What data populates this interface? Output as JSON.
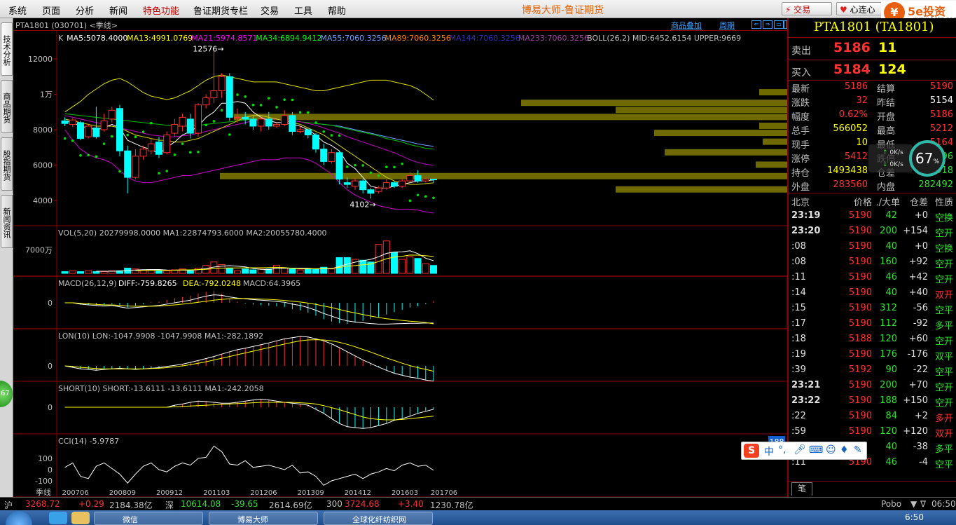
{
  "menubar": {
    "items": [
      "系统",
      "页面",
      "分析",
      "新闻",
      "特色功能",
      "鲁证期货专栏",
      "交易",
      "工具",
      "帮助"
    ],
    "app_title": "博易大师-鲁证期货",
    "trade_button": "交易",
    "xinlian_button": "心连心",
    "logo_brand": "5e投资",
    "logo_url": "www.5etz.com"
  },
  "left_tabs": [
    "技术分析",
    "商品期货",
    "股指期货",
    "新闻资讯"
  ],
  "float_ball": "67",
  "chart": {
    "symbol": "PTA1801 (030701) <季线>",
    "links": [
      "商品叠加",
      "周期"
    ],
    "nav_icons": [
      "prev-icon",
      "next-icon",
      "zoom-in-icon",
      "zoom-out-icon"
    ],
    "ma_line": [
      {
        "text": "K",
        "color": "#c0c0c0"
      },
      {
        "text": "MA5:5078.4000",
        "color": "#ffffff"
      },
      {
        "text": "MA13:4991.0769",
        "color": "#ffff00"
      },
      {
        "text": "MA21:5974.8571",
        "color": "#ff00ff"
      },
      {
        "text": "MA34:6894.9412",
        "color": "#00ff00"
      },
      {
        "text": "MA55:7060.3256",
        "color": "#6ea0ff"
      },
      {
        "text": "MA89:7060.3256",
        "color": "#ff8000"
      },
      {
        "text": "MA144:7060.3256",
        "color": "#3030c0"
      },
      {
        "text": "MA233:7060.3256",
        "color": "#a040a0"
      },
      {
        "text": "BOLL(26,2) MID:6452.6154 UPPER:9669",
        "color": "#c0c0c0"
      }
    ],
    "price_ylabels": [
      "12000",
      "1万",
      "8000",
      "6000",
      "4000"
    ],
    "annotations": {
      "high": "12576→",
      "low": "4102→"
    },
    "vol_label": "VOL(5,20) 20279998.0000 MA1:22874793.6000 MA2:20055780.4000",
    "vol_ylabel": "7000万",
    "macd_label_parts": [
      {
        "text": "MACD(26,12,9)",
        "color": "#c0c0c0"
      },
      {
        "text": "DIFF:-759.8265",
        "color": "#ffffff"
      },
      {
        "text": "DEA:-792.0248",
        "color": "#ffff00"
      },
      {
        "text": "MACD:64.3965",
        "color": "#c0c0c0"
      }
    ],
    "lon_label": "LON(10) LON:-1047.9908 -1047.9908 MA1:-282.1892",
    "short_label": "SHORT(10) SHORT:-13.6111 -13.6111 MA1:-242.2058",
    "cci_label": "CCI(14) -5.9787",
    "zero_label": "0",
    "cci_ylabels": [
      "100",
      "0",
      "-100"
    ],
    "x_axis": {
      "period": "季线",
      "labels": [
        "200706",
        "200809",
        "200912",
        "201103",
        "201206",
        "201309",
        "201412",
        "201603",
        "201706"
      ]
    },
    "badge_188": "188"
  },
  "quote": {
    "title": "PTA1801 (TA1801)",
    "sell": {
      "label": "卖出",
      "price": "5186",
      "vol": "11"
    },
    "buy": {
      "label": "买入",
      "price": "5184",
      "vol": "124"
    },
    "rows": [
      {
        "k1": "最新",
        "v1": "5186",
        "c1": "#ff3030",
        "k2": "结算",
        "v2": "5190",
        "c2": "#ff3030"
      },
      {
        "k1": "涨跌",
        "v1": "32",
        "c1": "#ff3030",
        "k2": "昨结",
        "v2": "5154",
        "c2": "#ffffff"
      },
      {
        "k1": "幅度",
        "v1": "0.62%",
        "c1": "#ff3030",
        "k2": "开盘",
        "v2": "5186",
        "c2": "#ff3030"
      },
      {
        "k1": "总手",
        "v1": "566052",
        "c1": "#ffff00",
        "k2": "最高",
        "v2": "5212",
        "c2": "#ff3030"
      },
      {
        "k1": "现手",
        "v1": "10",
        "c1": "#ffff00",
        "k2": "最低",
        "v2": "5164",
        "c2": "#ff3030"
      },
      {
        "k1": "涨停",
        "v1": "5412",
        "c1": "#ff3030",
        "k2": "跌停",
        "v2": "4896",
        "c2": "#30e030"
      },
      {
        "k1": "持仓",
        "v1": "1493438",
        "c1": "#ffff00",
        "k2": "仓差",
        "v2": "-12918",
        "c2": "#30e030"
      },
      {
        "k1": "外盘",
        "v1": "283560",
        "c1": "#ff3030",
        "k2": "内盘",
        "v2": "282492",
        "c2": "#30e030"
      }
    ],
    "tick_header": {
      "time": "北京",
      "price": "价格",
      "vol": "./大单",
      "diff": "仓差",
      "nature": "性质"
    },
    "ticks": [
      {
        "t": "23:19",
        "p": "5190",
        "v": "42",
        "c": "+0",
        "n": "空换",
        "nc": "#30e030"
      },
      {
        "t": "23:20",
        "p": "5190",
        "v": "200",
        "c": "+154",
        "n": "空开",
        "nc": "#30e030"
      },
      {
        "t": ":08",
        "p": "5190",
        "v": "40",
        "c": "+0",
        "n": "空换",
        "nc": "#30e030"
      },
      {
        "t": ":08",
        "p": "5190",
        "v": "160",
        "c": "+92",
        "n": "空开",
        "nc": "#30e030"
      },
      {
        "t": ":11",
        "p": "5190",
        "v": "46",
        "c": "+42",
        "n": "空开",
        "nc": "#30e030"
      },
      {
        "t": ":14",
        "p": "5190",
        "v": "40",
        "c": "+40",
        "n": "双开",
        "nc": "#ff3030"
      },
      {
        "t": ":15",
        "p": "5190",
        "v": "312",
        "c": "-56",
        "n": "空平",
        "nc": "#30e030"
      },
      {
        "t": ":17",
        "p": "5190",
        "v": "112",
        "c": "-92",
        "n": "多平",
        "nc": "#30e030"
      },
      {
        "t": ":18",
        "p": "5188",
        "v": "120",
        "c": "+60",
        "n": "空开",
        "nc": "#30e030"
      },
      {
        "t": ":19",
        "p": "5190",
        "v": "176",
        "c": "-176",
        "n": "双平",
        "nc": "#30e030"
      },
      {
        "t": ":39",
        "p": "5192",
        "v": "90",
        "c": "-22",
        "n": "空平",
        "nc": "#30e030"
      },
      {
        "t": "23:21",
        "p": "5190",
        "v": "200",
        "c": "+70",
        "n": "空开",
        "nc": "#30e030"
      },
      {
        "t": "23:22",
        "p": "5190",
        "v": "188",
        "c": "+150",
        "n": "空开",
        "nc": "#30e030"
      },
      {
        "t": ":22",
        "p": "5190",
        "v": "84",
        "c": "+2",
        "n": "多开",
        "nc": "#ff3030"
      },
      {
        "t": ":59",
        "p": "5190",
        "v": "120",
        "c": "+120",
        "n": "双开",
        "nc": "#ff3030"
      },
      {
        "t": "",
        "p": "",
        "v": "40",
        "c": "-38",
        "n": "多平",
        "nc": "#30e030"
      },
      {
        "t": ":11",
        "p": "5190",
        "v": "46",
        "c": "-4",
        "n": "空平",
        "nc": "#30e030"
      }
    ],
    "pen_tab": "笔"
  },
  "gauge": {
    "up": "0K/s",
    "down": "0K/s",
    "percent": "67",
    "unit": "%"
  },
  "ime": {
    "logo": "S",
    "mode": "中"
  },
  "status": {
    "sh": {
      "name": "沪",
      "value": "3268.72",
      "change": "+0.29",
      "amount": "2184.38亿"
    },
    "sz": {
      "name": "深",
      "value": "10614.08",
      "change": "-39.65",
      "amount": "2614.69亿"
    },
    "i300": {
      "name": "300",
      "value": "3724.68",
      "change": "+3.40",
      "amount": "1230.78亿"
    },
    "pobo": "Pobo",
    "time": "06:50"
  },
  "taskbar": {
    "items": [
      "微信",
      "博易大师",
      "全球化纤纺织网"
    ],
    "clock": "6:50"
  },
  "series": {
    "candles": [
      [
        8500,
        8350,
        8700,
        8200
      ],
      [
        8300,
        8550,
        8650,
        8150
      ],
      [
        8400,
        7500,
        8500,
        7400
      ],
      [
        7600,
        8200,
        8300,
        7500
      ],
      [
        8100,
        7600,
        9300,
        7500
      ],
      [
        8000,
        8500,
        8900,
        7900
      ],
      [
        8600,
        9100,
        9300,
        8400
      ],
      [
        9200,
        6800,
        9400,
        6500
      ],
      [
        6800,
        5300,
        7100,
        4400
      ],
      [
        5300,
        6500,
        6900,
        5200
      ],
      [
        6500,
        6900,
        7100,
        6300
      ],
      [
        6800,
        7200,
        7500,
        6600
      ],
      [
        7300,
        6600,
        7600,
        6400
      ],
      [
        6700,
        7700,
        7900,
        6600
      ],
      [
        7800,
        8300,
        8600,
        7600
      ],
      [
        8200,
        8700,
        8900,
        7900
      ],
      [
        8600,
        7800,
        8900,
        7500
      ],
      [
        7800,
        9400,
        9500,
        7600
      ],
      [
        9400,
        9800,
        10000,
        9200
      ],
      [
        9800,
        10200,
        12576,
        9500
      ],
      [
        10200,
        11000,
        11200,
        9800
      ],
      [
        11000,
        8700,
        11200,
        8500
      ],
      [
        8700,
        8700,
        9200,
        8400
      ],
      [
        8700,
        8600,
        9000,
        8300
      ],
      [
        8600,
        8200,
        8800,
        8000
      ],
      [
        8200,
        8600,
        8700,
        7900
      ],
      [
        8600,
        8200,
        9000,
        8000
      ],
      [
        8200,
        8300,
        8400,
        8100
      ],
      [
        8300,
        8800,
        9100,
        8200
      ],
      [
        8800,
        7900,
        9000,
        7700
      ],
      [
        7900,
        8000,
        8200,
        7800
      ],
      [
        8000,
        7700,
        8100,
        7500
      ],
      [
        7700,
        6900,
        7800,
        6700
      ],
      [
        6900,
        6200,
        7200,
        6000
      ],
      [
        6200,
        6700,
        6900,
        6100
      ],
      [
        6700,
        5200,
        6800,
        4900
      ],
      [
        5000,
        4900,
        5300,
        4700
      ],
      [
        4800,
        5100,
        5300,
        4600
      ],
      [
        5100,
        4600,
        5200,
        4400
      ],
      [
        4600,
        4400,
        4700,
        4102
      ],
      [
        4500,
        4700,
        4800,
        4400
      ],
      [
        4700,
        5000,
        5200,
        4600
      ],
      [
        5000,
        4800,
        5100,
        4700
      ],
      [
        4800,
        5100,
        5200,
        4700
      ],
      [
        5100,
        5400,
        5600,
        5000
      ],
      [
        5400,
        5100,
        5700,
        5000
      ],
      [
        5100,
        5200,
        5300,
        5000
      ],
      [
        5200,
        5186,
        5212,
        5000
      ]
    ],
    "ma5": [
      8500,
      8400,
      8200,
      8100,
      8000,
      8100,
      8300,
      8100,
      7400,
      7200,
      7000,
      6900,
      6600,
      7000,
      7300,
      7700,
      7900,
      8200,
      8700,
      9000,
      9500,
      9500,
      9600,
      9500,
      9000,
      8700,
      8500,
      8400,
      8400,
      8300,
      8200,
      8000,
      7700,
      7300,
      7100,
      6800,
      6100,
      5800,
      5300,
      4800,
      4700,
      4700,
      4800,
      4900,
      5000,
      5100,
      5100,
      5150
    ],
    "ma13": [
      8600,
      8500,
      8400,
      8300,
      8200,
      8200,
      8200,
      8100,
      7900,
      7700,
      7600,
      7500,
      7400,
      7400,
      7300,
      7300,
      7400,
      7500,
      7700,
      7900,
      8100,
      8300,
      8500,
      8700,
      8800,
      8800,
      8700,
      8600,
      8500,
      8400,
      8300,
      8100,
      7900,
      7700,
      7400,
      7100,
      6800,
      6500,
      6200,
      5900,
      5600,
      5300,
      5100,
      5000,
      4900,
      4900,
      4950,
      4990
    ],
    "ma21": [
      8800,
      8700,
      8600,
      8500,
      8400,
      8300,
      8200,
      8100,
      8000,
      7900,
      7800,
      7700,
      7650,
      7600,
      7600,
      7650,
      7700,
      7800,
      7900,
      8000,
      8100,
      8200,
      8300,
      8400,
      8500,
      8550,
      8600,
      8600,
      8550,
      8500,
      8450,
      8350,
      8250,
      8100,
      7950,
      7800,
      7600,
      7450,
      7300,
      7150,
      7000,
      6850,
      6700,
      6500,
      6300,
      6150,
      6050,
      5975
    ],
    "ma34": [
      8900,
      8850,
      8800,
      8750,
      8700,
      8650,
      8600,
      8550,
      8500,
      8450,
      8400,
      8350,
      8300,
      8250,
      8200,
      8200,
      8200,
      8250,
      8300,
      8350,
      8400,
      8450,
      8500,
      8550,
      8600,
      8600,
      8600,
      8600,
      8550,
      8500,
      8450,
      8400,
      8350,
      8300,
      8250,
      8150,
      8050,
      7950,
      7850,
      7750,
      7650,
      7500,
      7400,
      7300,
      7150,
      7050,
      6950,
      6895
    ],
    "ma55": [
      null,
      null,
      null,
      null,
      null,
      null,
      null,
      null,
      null,
      null,
      null,
      null,
      null,
      null,
      null,
      null,
      null,
      null,
      null,
      null,
      null,
      null,
      null,
      null,
      null,
      null,
      null,
      null,
      null,
      null,
      null,
      null,
      8350,
      8300,
      8250,
      8200,
      8100,
      8000,
      7900,
      7800,
      7700,
      7600,
      7500,
      7400,
      7300,
      7200,
      7120,
      7060
    ],
    "boll_upper": [
      9000,
      9300,
      9600,
      10000,
      10300,
      10600,
      10800,
      10900,
      10700,
      10400,
      10100,
      9900,
      9800,
      9700,
      9800,
      10000,
      10200,
      10500,
      10800,
      11000,
      11100,
      11000,
      10900,
      10800,
      10700,
      10700,
      10700,
      10700,
      10600,
      10500,
      10400,
      10300,
      10200,
      10200,
      10300,
      10400,
      10500,
      10600,
      10700,
      10800,
      10800,
      10800,
      10700,
      10600,
      10500,
      10300,
      10000,
      9669
    ],
    "boll_lower": [
      8000,
      7400,
      6900,
      6600,
      6400,
      6300,
      6100,
      5700,
      5300,
      5100,
      5000,
      5000,
      5100,
      5200,
      5300,
      5400,
      5400,
      5500,
      5600,
      5700,
      5800,
      5900,
      6000,
      6100,
      6200,
      6300,
      6300,
      6300,
      6400,
      6400,
      6400,
      6300,
      6100,
      5800,
      5500,
      5000,
      4600,
      4300,
      4100,
      3900,
      3700,
      3600,
      3500,
      3500,
      3500,
      3450,
      3350,
      3280
    ],
    "sar": [
      null,
      null,
      null,
      null,
      null,
      null,
      null,
      null,
      null,
      null,
      null,
      null,
      null,
      null,
      null,
      null,
      null,
      null,
      null,
      null,
      null,
      null,
      null,
      null,
      null,
      null,
      null,
      null,
      null,
      null,
      null,
      null,
      null,
      null,
      null,
      null,
      null,
      null,
      null,
      null,
      null,
      null,
      null,
      null,
      null,
      null,
      null,
      null
    ],
    "volume": [
      0.2,
      0.3,
      0.2,
      0.3,
      0.2,
      0.2,
      0.3,
      0.3,
      0.6,
      0.5,
      0.4,
      0.4,
      0.3,
      0.3,
      0.4,
      0.5,
      0.3,
      0.6,
      0.9,
      1.3,
      1.0,
      0.6,
      0.3,
      0.5,
      0.4,
      0.5,
      0.5,
      0.9,
      0.6,
      0.5,
      0.4,
      0.5,
      0.5,
      0.7,
      0.5,
      1.8,
      1.8,
      1.6,
      1.5,
      1.3,
      3.3,
      3.7,
      2.4,
      1.6,
      1.9,
      1.7,
      1.1,
      0.9
    ],
    "macd_diff": [
      0,
      0,
      -5,
      -8,
      -10,
      -12,
      -10,
      -15,
      -20,
      -18,
      -15,
      -12,
      -10,
      -5,
      0,
      5,
      10,
      18,
      25,
      30,
      28,
      22,
      18,
      15,
      12,
      10,
      8,
      5,
      2,
      -5,
      -10,
      -18,
      -28,
      -40,
      -50,
      -60,
      -68,
      -72,
      -75,
      -78,
      -80,
      -80,
      -79,
      -78,
      -77,
      -77,
      -76,
      -76
    ],
    "macd_dea": [
      0,
      0,
      -2,
      -4,
      -6,
      -8,
      -8,
      -10,
      -12,
      -13,
      -13,
      -13,
      -12,
      -10,
      -8,
      -5,
      -2,
      2,
      6,
      10,
      13,
      15,
      16,
      16,
      15,
      14,
      13,
      11,
      9,
      6,
      3,
      -1,
      -6,
      -12,
      -18,
      -25,
      -32,
      -38,
      -44,
      -50,
      -55,
      -60,
      -63,
      -66,
      -69,
      -71,
      -74,
      -79
    ],
    "lon": [
      0,
      -5,
      -10,
      -12,
      -15,
      -12,
      -10,
      -8,
      -10,
      -12,
      -10,
      -8,
      -6,
      -2,
      2,
      6,
      12,
      18,
      25,
      32,
      40,
      48,
      55,
      60,
      66,
      72,
      78,
      85,
      92,
      96,
      100,
      98,
      92,
      85,
      75,
      62,
      48,
      34,
      20,
      8,
      -4,
      -15,
      -25,
      -32,
      -38,
      -42,
      -48,
      -52
    ],
    "lon_ma": [
      0,
      -2,
      -5,
      -7,
      -9,
      -10,
      -10,
      -10,
      -10,
      -10,
      -10,
      -9,
      -8,
      -6,
      -3,
      0,
      4,
      9,
      14,
      20,
      26,
      32,
      38,
      44,
      50,
      56,
      62,
      68,
      74,
      80,
      85,
      88,
      89,
      88,
      85,
      80,
      73,
      65,
      56,
      47,
      37,
      27,
      18,
      9,
      1,
      -6,
      -12,
      -18
    ],
    "short": [
      0,
      0,
      0,
      0,
      0,
      0,
      0,
      0,
      0,
      0,
      0,
      0,
      0,
      0,
      5,
      8,
      12,
      15,
      14,
      12,
      10,
      10,
      12,
      15,
      18,
      20,
      18,
      15,
      12,
      10,
      8,
      5,
      -5,
      -15,
      -28,
      -40,
      -48,
      -50,
      -52,
      -50,
      -45,
      -40,
      -32,
      -28,
      -22,
      -15,
      -10,
      -5
    ],
    "short_ma": [
      0,
      0,
      0,
      0,
      0,
      0,
      0,
      0,
      0,
      0,
      0,
      0,
      0,
      0,
      1,
      2,
      3,
      4,
      5,
      6,
      7,
      8,
      9,
      10,
      11,
      12,
      12,
      12,
      12,
      12,
      11,
      10,
      8,
      4,
      -1,
      -6,
      -12,
      -18,
      -24,
      -28,
      -30,
      -31,
      -31,
      -30,
      -28,
      -26,
      -24,
      -22
    ],
    "cci": [
      20,
      60,
      -60,
      -80,
      30,
      60,
      10,
      -40,
      -120,
      -40,
      30,
      60,
      0,
      -20,
      30,
      60,
      40,
      100,
      110,
      210,
      160,
      50,
      40,
      80,
      20,
      30,
      40,
      20,
      0,
      40,
      -30,
      -20,
      -60,
      -140,
      -100,
      -80,
      -60,
      -40,
      -80,
      -40,
      -20,
      10,
      -10,
      40,
      60,
      30,
      40,
      -6
    ]
  }
}
